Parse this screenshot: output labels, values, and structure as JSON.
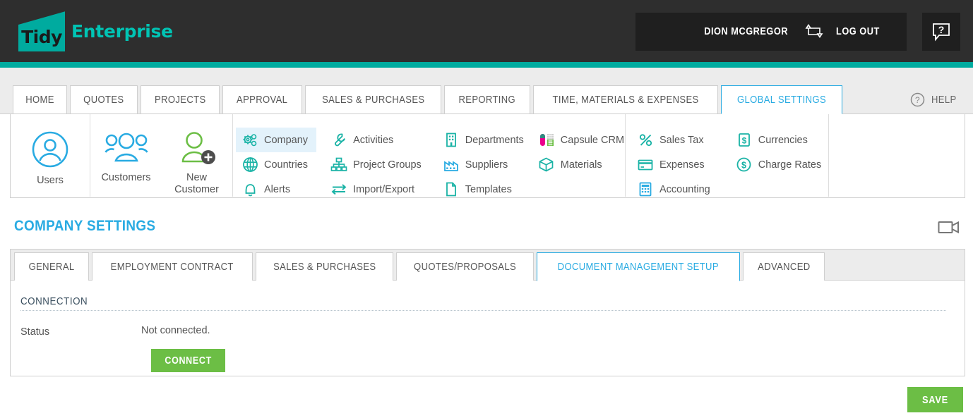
{
  "header": {
    "logo_mark_text": "Tidy",
    "logo_word": "Enterprise",
    "user_name": "DION MCGREGOR",
    "switch_icon": "switch-user-icon",
    "logout_label": "LOG OUT",
    "help_icon": "question-speech-bubble-icon",
    "accent_teal": "#00ab9f",
    "bar_background": "#2e2e2e"
  },
  "main_nav": {
    "tabs": [
      {
        "label": "HOME",
        "active": false
      },
      {
        "label": "QUOTES",
        "active": false
      },
      {
        "label": "PROJECTS",
        "active": false
      },
      {
        "label": "APPROVAL",
        "active": false
      },
      {
        "label": "SALES & PURCHASES",
        "active": false
      },
      {
        "label": "REPORTING",
        "active": false
      },
      {
        "label": "TIME, MATERIALS & EXPENSES",
        "active": false
      },
      {
        "label": "GLOBAL SETTINGS",
        "active": true
      }
    ],
    "help_label": "HELP",
    "help_icon": "question-circle-icon",
    "active_color": "#29abe2"
  },
  "ribbon": {
    "groups": [
      {
        "type": "big",
        "items": [
          {
            "label": "Users",
            "icon": "user-circle-icon",
            "color": "#29abe2"
          }
        ]
      },
      {
        "type": "big",
        "items": [
          {
            "label": "Customers",
            "icon": "users-group-icon",
            "color": "#29abe2"
          },
          {
            "label": "New\nCustomer",
            "label_line1": "New",
            "label_line2": "Customer",
            "icon": "user-add-icon",
            "color": "#6cbe45"
          }
        ]
      },
      {
        "type": "list",
        "columns": [
          [
            {
              "label": "Company",
              "icon": "gears-icon",
              "selected": true
            },
            {
              "label": "Countries",
              "icon": "globe-icon",
              "selected": false
            },
            {
              "label": "Alerts",
              "icon": "bell-icon",
              "selected": false
            }
          ],
          [
            {
              "label": "Activities",
              "icon": "wrench-icon",
              "selected": false
            },
            {
              "label": "Project Groups",
              "icon": "org-chart-icon",
              "selected": false
            },
            {
              "label": "Import/Export",
              "icon": "exchange-arrows-icon",
              "selected": false
            }
          ],
          [
            {
              "label": "Departments",
              "icon": "building-icon",
              "selected": false
            },
            {
              "label": "Suppliers",
              "icon": "factory-icon",
              "selected": false
            },
            {
              "label": "Templates",
              "icon": "document-icon",
              "selected": false
            }
          ],
          [
            {
              "label": "Capsule CRM",
              "icon": "capsule-crm-icon",
              "selected": false
            },
            {
              "label": "Materials",
              "icon": "cube-icon",
              "selected": false
            }
          ]
        ]
      },
      {
        "type": "list",
        "columns": [
          [
            {
              "label": "Sales Tax",
              "icon": "percent-icon",
              "selected": false
            },
            {
              "label": "Expenses",
              "icon": "credit-card-icon",
              "selected": false
            },
            {
              "label": "Accounting",
              "icon": "calculator-icon",
              "selected": false
            }
          ],
          [
            {
              "label": "Currencies",
              "icon": "dollar-square-icon",
              "selected": false
            },
            {
              "label": "Charge Rates",
              "icon": "dollar-circle-icon",
              "selected": false
            }
          ]
        ]
      }
    ],
    "icon_color": "#1ab3a6",
    "selected_background": "#e3f2fb"
  },
  "page": {
    "title": "COMPANY SETTINGS",
    "video_icon": "video-camera-icon"
  },
  "sub_tabs": [
    {
      "label": "GENERAL",
      "active": false
    },
    {
      "label": "EMPLOYMENT CONTRACT",
      "active": false
    },
    {
      "label": "SALES & PURCHASES",
      "active": false
    },
    {
      "label": "QUOTES/PROPOSALS",
      "active": false
    },
    {
      "label": "DOCUMENT MANAGEMENT SETUP",
      "active": true
    },
    {
      "label": "ADVANCED",
      "active": false
    }
  ],
  "content": {
    "section_title": "CONNECTION",
    "status_label": "Status",
    "status_value": "Not connected.",
    "connect_label": "CONNECT",
    "button_color": "#6cbe45"
  },
  "footer": {
    "save_label": "SAVE"
  }
}
